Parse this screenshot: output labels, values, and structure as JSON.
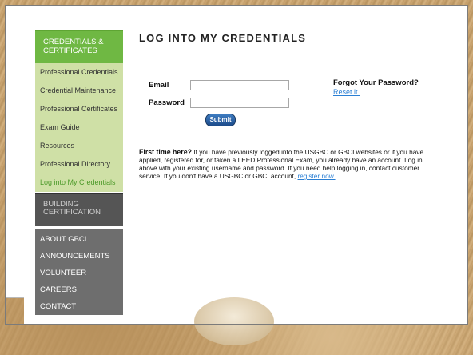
{
  "sidebar": {
    "section1_title": "CREDENTIALS & CERTIFICATES",
    "items": [
      {
        "label": "Professional Credentials"
      },
      {
        "label": "Credential Maintenance"
      },
      {
        "label": "Professional Certificates"
      },
      {
        "label": "Exam Guide"
      },
      {
        "label": "Resources"
      },
      {
        "label": "Professional Directory"
      },
      {
        "label": "Log into My Credentials"
      }
    ],
    "section2_title": "BUILDING CERTIFICATION",
    "gray_items": [
      {
        "label": "ABOUT GBCI"
      },
      {
        "label": "ANNOUNCEMENTS"
      },
      {
        "label": "VOLUNTEER"
      },
      {
        "label": "CAREERS"
      },
      {
        "label": "CONTACT"
      }
    ]
  },
  "main": {
    "title": "LOG INTO MY CREDENTIALS",
    "email_label": "Email",
    "password_label": "Password",
    "email_value": "",
    "password_value": "",
    "submit_label": "Submit",
    "forgot_title": "Forgot Your Password?",
    "reset_link": "Reset it.",
    "first_time_bold": "First time here?",
    "first_time_text": " If you have previously logged into the USGBC or GBCI websites or if you have applied, registered for, or taken a LEED Professional Exam, you already have an account. Log in above with your existing username and password. If you need help logging in, contact customer service. If you don't have a USGBC or GBCI account, ",
    "register_link": "register now."
  },
  "colors": {
    "green_header": "#6fb843",
    "green_nav": "#cfe0a6",
    "dark_header": "#555555",
    "gray_nav": "#6e6e6e",
    "link": "#2a7fd4"
  }
}
